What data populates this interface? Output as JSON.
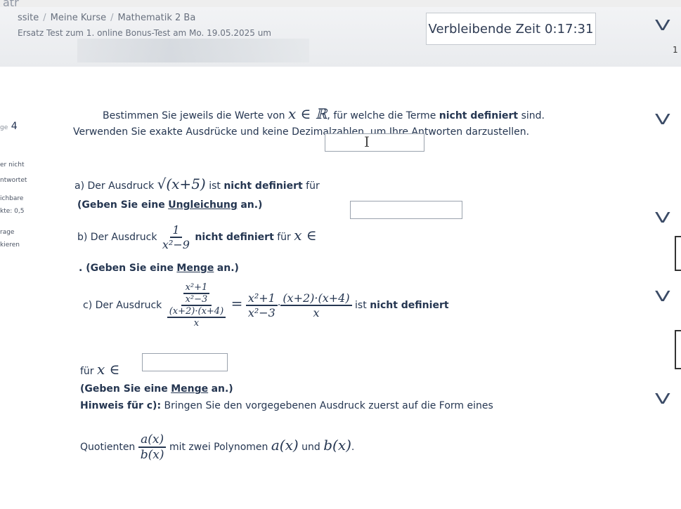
{
  "header": {
    "site_brand": "atr",
    "breadcrumb_root": "ssite",
    "breadcrumb_courses": "Meine Kurse",
    "breadcrumb_course": "Mathematik 2 Ba",
    "breadcrumb_quiz_prefix": "Ersatz",
    "breadcrumb_quiz": "Test zum 1. online Bonus-Test am Mo. 19.05.2025 um"
  },
  "timer": {
    "label": "Verbleibende Zeit",
    "value": "0:17:31"
  },
  "sidebar": {
    "question_prefix": "ge",
    "question_number": "4",
    "status": "er nicht",
    "status2": "ntwortet",
    "points_label": "ichbare",
    "points_value": "kte: 0,5",
    "flag_label": "rage",
    "flag_label2": "kieren"
  },
  "question": {
    "intro_line1_a": "Bestimmen Sie jeweils die Werte von",
    "intro_math": "x ∈ ℝ",
    "intro_line1_b": ", für welche die Terme",
    "intro_line1_bold": "nicht definiert",
    "intro_line1_c": "sind.",
    "intro_line2": "Verwenden Sie exakte Ausdrücke und keine Dezimalzahlen, um Ihre Antworten darzustellen.",
    "a_prefix": "a) Der Ausdruck",
    "a_math": "√(x+5)",
    "a_suffix_a": "ist",
    "a_suffix_bold": "nicht definiert",
    "a_suffix_c": "für",
    "a_hint_prefix": "(Geben Sie eine",
    "a_hint_word": "Ungleichung",
    "a_hint_suffix": "an.)",
    "b_prefix": "b) Der Ausdruck",
    "b_num": "1",
    "b_den": "x²−9",
    "b_suffix_bold": "nicht definiert",
    "b_suffix_c": "für",
    "b_math": "x ∈",
    "b_hint_prefix": ". (Geben Sie eine",
    "b_hint_word": "Menge",
    "b_hint_suffix": "an.)",
    "c_prefix": "c) Der Ausdruck",
    "c_inner_num": "x²+1",
    "c_inner_den": "x²−3",
    "c_outer_den_num": "(x+2)·(x+4)",
    "c_outer_den_den": "x",
    "c_eq": "=",
    "c_rhs1_num": "x²+1",
    "c_rhs1_den": "x²−3",
    "c_dot": "·",
    "c_rhs2_num": "(x+2)·(x+4)",
    "c_rhs2_den": "x",
    "c_suffix_a": "ist",
    "c_suffix_bold": "nicht definiert",
    "c_for": "für",
    "c_math": "x ∈",
    "c_hint_prefix": "(Geben Sie eine",
    "c_hint_word": "Menge",
    "c_hint_suffix": "an.)",
    "hint_label": "Hinweis für c):",
    "hint_text": "Bringen Sie den vorgegebenen Ausdruck zuerst auf die Form eines",
    "hint2_prefix": "Quotienten",
    "hint2_num": "a(x)",
    "hint2_den": "b(x)",
    "hint2_mid": "mit zwei Polynomen",
    "hint2_a": "a(x)",
    "hint2_und": "und",
    "hint2_b": "b(x)",
    "hint2_end": "."
  },
  "right_nav": {
    "num": "1"
  }
}
